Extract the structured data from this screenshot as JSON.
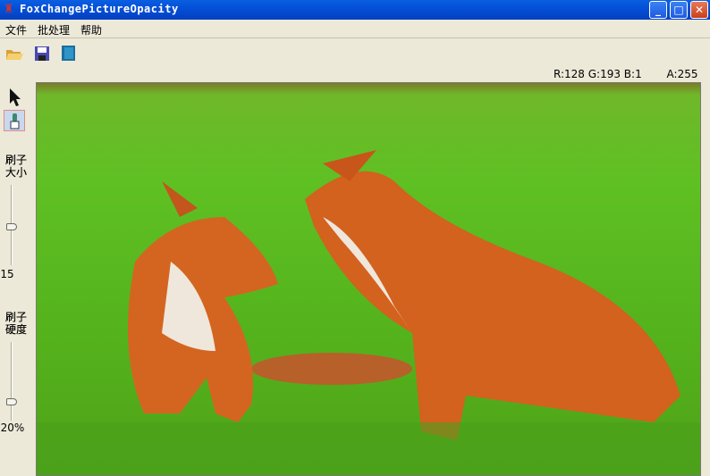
{
  "window": {
    "title": "FoxChangePictureOpacity",
    "buttons": {
      "minimize": "_",
      "maximize": "□",
      "close": "✕"
    }
  },
  "menu": [
    "文件",
    "批处理",
    "帮助"
  ],
  "toolbar": [
    "open-icon",
    "save-icon",
    "export-icon"
  ],
  "status": {
    "rgb": "R:128 G:193 B:1",
    "alpha": "A:255"
  },
  "tools": {
    "brush_size": {
      "label": "刷子大小",
      "label_line1": "刷子",
      "label_line2": "大小",
      "value": "15",
      "fraction": 0.55
    },
    "brush_hardness": {
      "label": "刷子硬度",
      "label_line1": "刷子",
      "label_line2": "硬度",
      "value": "20%",
      "fraction": 0.2
    }
  },
  "colors": {
    "titlebar": "#0450d8",
    "background": "#ece9d8"
  }
}
